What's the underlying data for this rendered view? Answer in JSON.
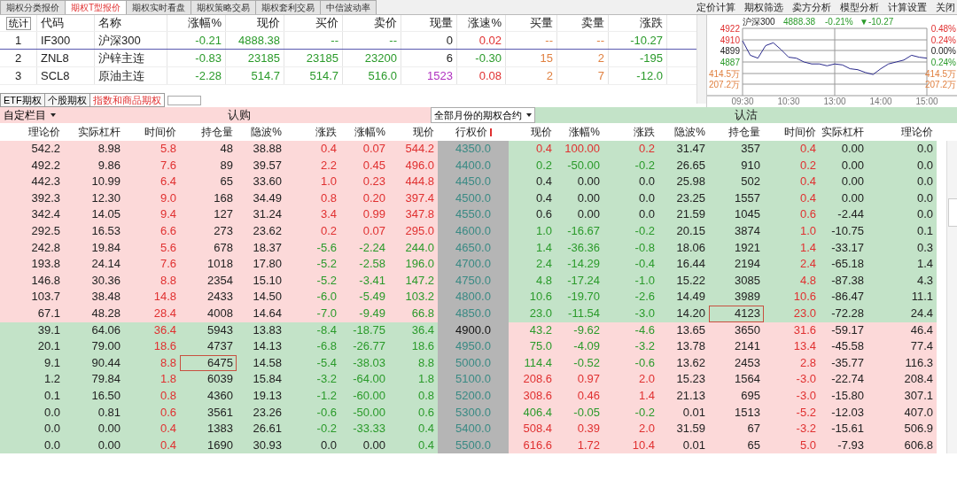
{
  "tabs": [
    {
      "label": "期权分类报价",
      "selected": false
    },
    {
      "label": "期权T型报价",
      "selected": true
    },
    {
      "label": "期权实时看盘",
      "selected": false
    },
    {
      "label": "期权策略交易",
      "selected": false
    },
    {
      "label": "期权套利交易",
      "selected": false
    },
    {
      "label": "中信波动率",
      "selected": false
    }
  ],
  "menu": [
    "定价计算",
    "期权筛选",
    "卖方分析",
    "模型分析",
    "计算设置",
    "关闭"
  ],
  "quotes": {
    "stat_button": "统计",
    "columns": [
      "代码",
      "名称",
      "涨幅%",
      "现价",
      "买价",
      "卖价",
      "现量",
      "涨速%",
      "买量",
      "卖量",
      "涨跌"
    ],
    "rows": [
      {
        "index": "1",
        "selected": true,
        "speed_up": true,
        "volume_large": false,
        "cells": [
          "IF300",
          "沪深300",
          "-0.21",
          "4888.38",
          "--",
          "--",
          "0",
          "0.02",
          "--",
          "--",
          "-10.27"
        ]
      },
      {
        "index": "2",
        "selected": false,
        "speed_up": false,
        "volume_large": false,
        "cells": [
          "ZNL8",
          "沪锌主连",
          "-0.83",
          "23185",
          "23185",
          "23200",
          "6",
          "-0.30",
          "15",
          "2",
          "-195"
        ]
      },
      {
        "index": "3",
        "selected": false,
        "speed_up": true,
        "volume_large": true,
        "cells": [
          "SCL8",
          "原油主连",
          "-2.28",
          "514.7",
          "514.7",
          "516.0",
          "1523",
          "0.08",
          "2",
          "7",
          "-12.0"
        ]
      }
    ]
  },
  "mini_chart": {
    "title": "沪深300",
    "price": "4888.38",
    "pct": "-0.21%",
    "change": "▼-10.27",
    "volume_labels": [
      "414.5万",
      "207.2万"
    ],
    "right_labels": [
      "0.48%",
      "0.24%",
      "0.00%",
      "0.24%",
      "414.5万",
      "207.2万"
    ],
    "chart_data": {
      "type": "line",
      "categories": [
        "09:30",
        null,
        null,
        null,
        null,
        null,
        "10:30",
        null,
        null,
        null,
        null,
        null,
        "13:00",
        null,
        null,
        null,
        null,
        null,
        "14:00",
        null,
        null,
        null,
        null,
        null,
        "15:00"
      ],
      "series": [
        {
          "color": "#2a2a8c",
          "values": [
            4909,
            4894,
            4891,
            4904,
            4907,
            4900,
            4892,
            4891,
            4887,
            4885,
            4885,
            4883,
            4885,
            4884,
            4880,
            4879,
            4876,
            4874,
            4880,
            4885,
            4887,
            4889,
            4894,
            4892,
            4891
          ]
        }
      ],
      "ylim": [
        4852,
        4922
      ],
      "grid": true,
      "yticks": [
        {
          "value": 4922,
          "label": "4922"
        },
        {
          "value": 4910,
          "label": "4910"
        },
        {
          "value": 4899,
          "label": "4899"
        },
        {
          "value": 4887,
          "label": "4887"
        }
      ]
    }
  },
  "sheet_tabs": [
    {
      "label": "ETF期权",
      "selected": false
    },
    {
      "label": "个股期权",
      "selected": false
    },
    {
      "label": "指数和商品期权",
      "selected": true
    }
  ],
  "custom_columns": "自定栏目",
  "call_label": "认购",
  "month_select": "全部月份的期权合约",
  "put_label": "认沽",
  "call_columns": [
    "理论价",
    "实际杠杆",
    "时间价",
    "持仓量",
    "隐波%",
    "涨跌",
    "涨幅%",
    "现价"
  ],
  "strike_column": "行权价",
  "put_columns": [
    "现价",
    "涨幅%",
    "涨跌",
    "隐波%",
    "持仓量",
    "时间价",
    "实际杠杆",
    "理论价"
  ],
  "rows": [
    {
      "strike": "4350.0",
      "atm": false,
      "call_itm": true,
      "call": [
        "542.2",
        "8.98",
        "5.8",
        "48",
        "38.88"
      ],
      "call_change": [
        {
          "text": "0.4",
          "color": "#e03030"
        },
        {
          "text": "0.07",
          "color": "#e03030"
        },
        {
          "text": "544.2",
          "color": "#e03030"
        }
      ],
      "call_oi_selected": false,
      "put_change": [
        {
          "text": "0.4",
          "color": "#e03030"
        },
        {
          "text": "100.00",
          "color": "#e03030"
        },
        {
          "text": "0.2",
          "color": "#e03030"
        }
      ],
      "put": [
        "31.47",
        "357",
        "0.4",
        "0.00",
        "0.0"
      ],
      "put_oi_selected": false
    },
    {
      "strike": "4400.0",
      "atm": false,
      "call_itm": true,
      "call": [
        "492.2",
        "9.86",
        "7.6",
        "89",
        "39.57"
      ],
      "call_change": [
        {
          "text": "2.2",
          "color": "#e03030"
        },
        {
          "text": "0.45",
          "color": "#e03030"
        },
        {
          "text": "496.0",
          "color": "#e03030"
        }
      ],
      "call_oi_selected": false,
      "put_change": [
        {
          "text": "0.2",
          "color": "#2a9a2a"
        },
        {
          "text": "-50.00",
          "color": "#2a9a2a"
        },
        {
          "text": "-0.2",
          "color": "#2a9a2a"
        }
      ],
      "put": [
        "26.65",
        "910",
        "0.2",
        "0.00",
        "0.0"
      ],
      "put_oi_selected": false
    },
    {
      "strike": "4450.0",
      "atm": false,
      "call_itm": true,
      "call": [
        "442.3",
        "10.99",
        "6.4",
        "65",
        "33.60"
      ],
      "call_change": [
        {
          "text": "1.0",
          "color": "#e03030"
        },
        {
          "text": "0.23",
          "color": "#e03030"
        },
        {
          "text": "444.8",
          "color": "#e03030"
        }
      ],
      "call_oi_selected": false,
      "put_change": [
        {
          "text": "0.4",
          "color": "#222222"
        },
        {
          "text": "0.00",
          "color": "#222222"
        },
        {
          "text": "0.0",
          "color": "#222222"
        }
      ],
      "put": [
        "25.98",
        "502",
        "0.4",
        "0.00",
        "0.0"
      ],
      "put_oi_selected": false
    },
    {
      "strike": "4500.0",
      "atm": false,
      "call_itm": true,
      "call": [
        "392.3",
        "12.30",
        "9.0",
        "168",
        "34.49"
      ],
      "call_change": [
        {
          "text": "0.8",
          "color": "#e03030"
        },
        {
          "text": "0.20",
          "color": "#e03030"
        },
        {
          "text": "397.4",
          "color": "#e03030"
        }
      ],
      "call_oi_selected": false,
      "put_change": [
        {
          "text": "0.4",
          "color": "#222222"
        },
        {
          "text": "0.00",
          "color": "#222222"
        },
        {
          "text": "0.0",
          "color": "#222222"
        }
      ],
      "put": [
        "23.25",
        "1557",
        "0.4",
        "0.00",
        "0.0"
      ],
      "put_oi_selected": false
    },
    {
      "strike": "4550.0",
      "atm": false,
      "call_itm": true,
      "call": [
        "342.4",
        "14.05",
        "9.4",
        "127",
        "31.24"
      ],
      "call_change": [
        {
          "text": "3.4",
          "color": "#e03030"
        },
        {
          "text": "0.99",
          "color": "#e03030"
        },
        {
          "text": "347.8",
          "color": "#e03030"
        }
      ],
      "call_oi_selected": false,
      "put_change": [
        {
          "text": "0.6",
          "color": "#222222"
        },
        {
          "text": "0.00",
          "color": "#222222"
        },
        {
          "text": "0.0",
          "color": "#222222"
        }
      ],
      "put": [
        "21.59",
        "1045",
        "0.6",
        "-2.44",
        "0.0"
      ],
      "put_oi_selected": false
    },
    {
      "strike": "4600.0",
      "atm": false,
      "call_itm": true,
      "call": [
        "292.5",
        "16.53",
        "6.6",
        "273",
        "23.62"
      ],
      "call_change": [
        {
          "text": "0.2",
          "color": "#e03030"
        },
        {
          "text": "0.07",
          "color": "#e03030"
        },
        {
          "text": "295.0",
          "color": "#e03030"
        }
      ],
      "call_oi_selected": false,
      "put_change": [
        {
          "text": "1.0",
          "color": "#2a9a2a"
        },
        {
          "text": "-16.67",
          "color": "#2a9a2a"
        },
        {
          "text": "-0.2",
          "color": "#2a9a2a"
        }
      ],
      "put": [
        "20.15",
        "3874",
        "1.0",
        "-10.75",
        "0.1"
      ],
      "put_oi_selected": false
    },
    {
      "strike": "4650.0",
      "atm": false,
      "call_itm": true,
      "call": [
        "242.8",
        "19.84",
        "5.6",
        "678",
        "18.37"
      ],
      "call_change": [
        {
          "text": "-5.6",
          "color": "#2a9a2a"
        },
        {
          "text": "-2.24",
          "color": "#2a9a2a"
        },
        {
          "text": "244.0",
          "color": "#2a9a2a"
        }
      ],
      "call_oi_selected": false,
      "put_change": [
        {
          "text": "1.4",
          "color": "#2a9a2a"
        },
        {
          "text": "-36.36",
          "color": "#2a9a2a"
        },
        {
          "text": "-0.8",
          "color": "#2a9a2a"
        }
      ],
      "put": [
        "18.06",
        "1921",
        "1.4",
        "-33.17",
        "0.3"
      ],
      "put_oi_selected": false
    },
    {
      "strike": "4700.0",
      "atm": false,
      "call_itm": true,
      "call": [
        "193.8",
        "24.14",
        "7.6",
        "1018",
        "17.80"
      ],
      "call_change": [
        {
          "text": "-5.2",
          "color": "#2a9a2a"
        },
        {
          "text": "-2.58",
          "color": "#2a9a2a"
        },
        {
          "text": "196.0",
          "color": "#2a9a2a"
        }
      ],
      "call_oi_selected": false,
      "put_change": [
        {
          "text": "2.4",
          "color": "#2a9a2a"
        },
        {
          "text": "-14.29",
          "color": "#2a9a2a"
        },
        {
          "text": "-0.4",
          "color": "#2a9a2a"
        }
      ],
      "put": [
        "16.44",
        "2194",
        "2.4",
        "-65.18",
        "1.4"
      ],
      "put_oi_selected": false
    },
    {
      "strike": "4750.0",
      "atm": false,
      "call_itm": true,
      "call": [
        "146.8",
        "30.36",
        "8.8",
        "2354",
        "15.10"
      ],
      "call_change": [
        {
          "text": "-5.2",
          "color": "#2a9a2a"
        },
        {
          "text": "-3.41",
          "color": "#2a9a2a"
        },
        {
          "text": "147.2",
          "color": "#2a9a2a"
        }
      ],
      "call_oi_selected": false,
      "put_change": [
        {
          "text": "4.8",
          "color": "#2a9a2a"
        },
        {
          "text": "-17.24",
          "color": "#2a9a2a"
        },
        {
          "text": "-1.0",
          "color": "#2a9a2a"
        }
      ],
      "put": [
        "15.22",
        "3085",
        "4.8",
        "-87.38",
        "4.3"
      ],
      "put_oi_selected": false
    },
    {
      "strike": "4800.0",
      "atm": false,
      "call_itm": true,
      "call": [
        "103.7",
        "38.48",
        "14.8",
        "2433",
        "14.50"
      ],
      "call_change": [
        {
          "text": "-6.0",
          "color": "#2a9a2a"
        },
        {
          "text": "-5.49",
          "color": "#2a9a2a"
        },
        {
          "text": "103.2",
          "color": "#2a9a2a"
        }
      ],
      "call_oi_selected": false,
      "put_change": [
        {
          "text": "10.6",
          "color": "#2a9a2a"
        },
        {
          "text": "-19.70",
          "color": "#2a9a2a"
        },
        {
          "text": "-2.6",
          "color": "#2a9a2a"
        }
      ],
      "put": [
        "14.49",
        "3989",
        "10.6",
        "-86.47",
        "11.1"
      ],
      "put_oi_selected": false
    },
    {
      "strike": "4850.0",
      "atm": false,
      "call_itm": true,
      "call": [
        "67.1",
        "48.28",
        "28.4",
        "4008",
        "14.64"
      ],
      "call_change": [
        {
          "text": "-7.0",
          "color": "#2a9a2a"
        },
        {
          "text": "-9.49",
          "color": "#2a9a2a"
        },
        {
          "text": "66.8",
          "color": "#2a9a2a"
        }
      ],
      "call_oi_selected": false,
      "put_change": [
        {
          "text": "23.0",
          "color": "#2a9a2a"
        },
        {
          "text": "-11.54",
          "color": "#2a9a2a"
        },
        {
          "text": "-3.0",
          "color": "#2a9a2a"
        }
      ],
      "put": [
        "14.20",
        "4123",
        "23.0",
        "-72.28",
        "24.4"
      ],
      "put_oi_selected": true
    },
    {
      "strike": "4900.0",
      "atm": true,
      "call_itm": false,
      "call": [
        "39.1",
        "64.06",
        "36.4",
        "5943",
        "13.83"
      ],
      "call_change": [
        {
          "text": "-8.4",
          "color": "#2a9a2a"
        },
        {
          "text": "-18.75",
          "color": "#2a9a2a"
        },
        {
          "text": "36.4",
          "color": "#2a9a2a"
        }
      ],
      "call_oi_selected": false,
      "put_change": [
        {
          "text": "43.2",
          "color": "#2a9a2a"
        },
        {
          "text": "-9.62",
          "color": "#2a9a2a"
        },
        {
          "text": "-4.6",
          "color": "#2a9a2a"
        }
      ],
      "put": [
        "13.65",
        "3650",
        "31.6",
        "-59.17",
        "46.4"
      ],
      "put_oi_selected": false
    },
    {
      "strike": "4950.0",
      "atm": false,
      "call_itm": false,
      "call": [
        "20.1",
        "79.00",
        "18.6",
        "4737",
        "14.13"
      ],
      "call_change": [
        {
          "text": "-6.8",
          "color": "#2a9a2a"
        },
        {
          "text": "-26.77",
          "color": "#2a9a2a"
        },
        {
          "text": "18.6",
          "color": "#2a9a2a"
        }
      ],
      "call_oi_selected": false,
      "put_change": [
        {
          "text": "75.0",
          "color": "#2a9a2a"
        },
        {
          "text": "-4.09",
          "color": "#2a9a2a"
        },
        {
          "text": "-3.2",
          "color": "#2a9a2a"
        }
      ],
      "put": [
        "13.78",
        "2141",
        "13.4",
        "-45.58",
        "77.4"
      ],
      "put_oi_selected": false
    },
    {
      "strike": "5000.0",
      "atm": false,
      "call_itm": false,
      "call": [
        "9.1",
        "90.44",
        "8.8",
        "6475",
        "14.58"
      ],
      "call_change": [
        {
          "text": "-5.4",
          "color": "#2a9a2a"
        },
        {
          "text": "-38.03",
          "color": "#2a9a2a"
        },
        {
          "text": "8.8",
          "color": "#2a9a2a"
        }
      ],
      "call_oi_selected": true,
      "put_change": [
        {
          "text": "114.4",
          "color": "#2a9a2a"
        },
        {
          "text": "-0.52",
          "color": "#2a9a2a"
        },
        {
          "text": "-0.6",
          "color": "#2a9a2a"
        }
      ],
      "put": [
        "13.62",
        "2453",
        "2.8",
        "-35.77",
        "116.3"
      ],
      "put_oi_selected": false
    },
    {
      "strike": "5100.0",
      "atm": false,
      "call_itm": false,
      "call": [
        "1.2",
        "79.84",
        "1.8",
        "6039",
        "15.84"
      ],
      "call_change": [
        {
          "text": "-3.2",
          "color": "#2a9a2a"
        },
        {
          "text": "-64.00",
          "color": "#2a9a2a"
        },
        {
          "text": "1.8",
          "color": "#2a9a2a"
        }
      ],
      "call_oi_selected": false,
      "put_change": [
        {
          "text": "208.6",
          "color": "#e03030"
        },
        {
          "text": "0.97",
          "color": "#e03030"
        },
        {
          "text": "2.0",
          "color": "#e03030"
        }
      ],
      "put": [
        "15.23",
        "1564",
        "-3.0",
        "-22.74",
        "208.4"
      ],
      "put_oi_selected": false
    },
    {
      "strike": "5200.0",
      "atm": false,
      "call_itm": false,
      "call": [
        "0.1",
        "16.50",
        "0.8",
        "4360",
        "19.13"
      ],
      "call_change": [
        {
          "text": "-1.2",
          "color": "#2a9a2a"
        },
        {
          "text": "-60.00",
          "color": "#2a9a2a"
        },
        {
          "text": "0.8",
          "color": "#2a9a2a"
        }
      ],
      "call_oi_selected": false,
      "put_change": [
        {
          "text": "308.6",
          "color": "#e03030"
        },
        {
          "text": "0.46",
          "color": "#e03030"
        },
        {
          "text": "1.4",
          "color": "#e03030"
        }
      ],
      "put": [
        "21.13",
        "695",
        "-3.0",
        "-15.80",
        "307.1"
      ],
      "put_oi_selected": false
    },
    {
      "strike": "5300.0",
      "atm": false,
      "call_itm": false,
      "call": [
        "0.0",
        "0.81",
        "0.6",
        "3561",
        "23.26"
      ],
      "call_change": [
        {
          "text": "-0.6",
          "color": "#2a9a2a"
        },
        {
          "text": "-50.00",
          "color": "#2a9a2a"
        },
        {
          "text": "0.6",
          "color": "#2a9a2a"
        }
      ],
      "call_oi_selected": false,
      "put_change": [
        {
          "text": "406.4",
          "color": "#2a9a2a"
        },
        {
          "text": "-0.05",
          "color": "#2a9a2a"
        },
        {
          "text": "-0.2",
          "color": "#2a9a2a"
        }
      ],
      "put": [
        "0.01",
        "1513",
        "-5.2",
        "-12.03",
        "407.0"
      ],
      "put_oi_selected": false
    },
    {
      "strike": "5400.0",
      "atm": false,
      "call_itm": false,
      "call": [
        "0.0",
        "0.00",
        "0.4",
        "1383",
        "26.61"
      ],
      "call_change": [
        {
          "text": "-0.2",
          "color": "#2a9a2a"
        },
        {
          "text": "-33.33",
          "color": "#2a9a2a"
        },
        {
          "text": "0.4",
          "color": "#2a9a2a"
        }
      ],
      "call_oi_selected": false,
      "put_change": [
        {
          "text": "508.4",
          "color": "#e03030"
        },
        {
          "text": "0.39",
          "color": "#e03030"
        },
        {
          "text": "2.0",
          "color": "#e03030"
        }
      ],
      "put": [
        "31.59",
        "67",
        "-3.2",
        "-15.61",
        "506.9"
      ],
      "put_oi_selected": false
    },
    {
      "strike": "5500.0",
      "atm": false,
      "call_itm": false,
      "call": [
        "0.0",
        "0.00",
        "0.4",
        "1690",
        "30.93"
      ],
      "call_change": [
        {
          "text": "0.0",
          "color": "#222222"
        },
        {
          "text": "0.00",
          "color": "#222222"
        },
        {
          "text": "0.4",
          "color": "#2a9a2a"
        }
      ],
      "call_oi_selected": false,
      "put_change": [
        {
          "text": "616.6",
          "color": "#e03030"
        },
        {
          "text": "1.72",
          "color": "#e03030"
        },
        {
          "text": "10.4",
          "color": "#e03030"
        }
      ],
      "put": [
        "0.01",
        "65",
        "5.0",
        "-7.93",
        "606.8"
      ],
      "put_oi_selected": false
    }
  ]
}
